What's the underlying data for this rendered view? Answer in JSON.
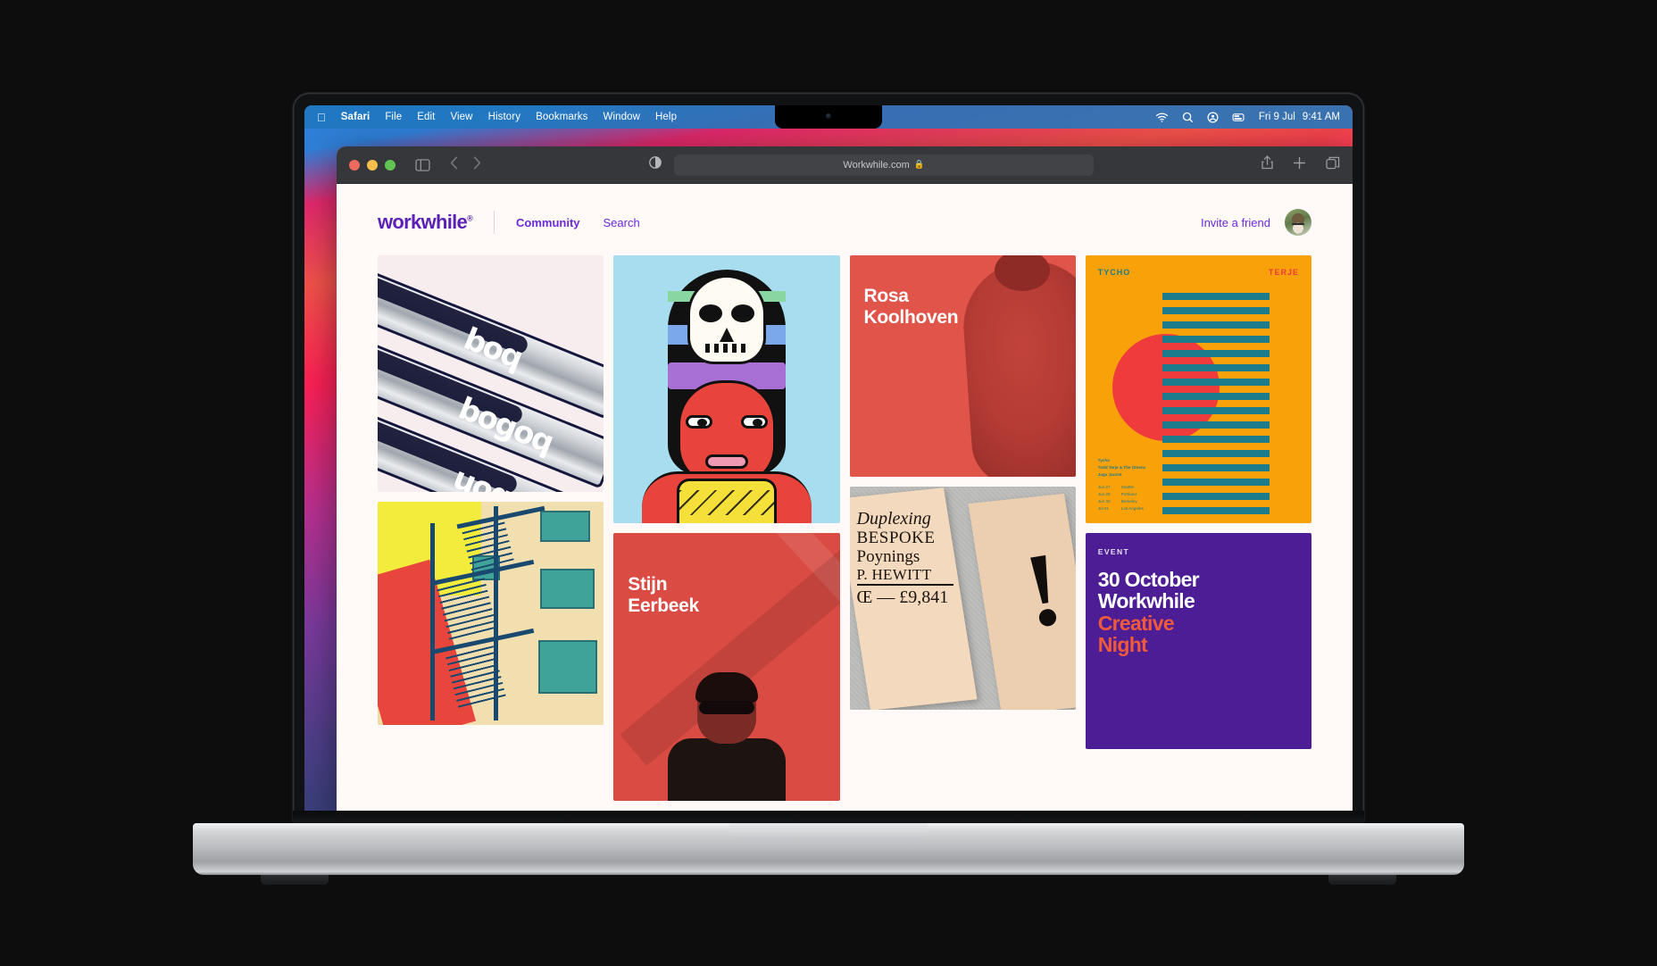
{
  "menubar": {
    "apple_icon": "apple-logo",
    "items": [
      "Safari",
      "File",
      "Edit",
      "View",
      "History",
      "Bookmarks",
      "Window",
      "Help"
    ],
    "active_app": "Safari",
    "status_icons": [
      "wifi-icon",
      "search-icon",
      "control-center-icon",
      "battery-icon"
    ],
    "date": "Fri 9 Jul",
    "time": "9:41 AM"
  },
  "safari": {
    "traffic_lights": [
      "close-button",
      "minimize-button",
      "zoom-button"
    ],
    "sidebar_icon": "sidebar-toggle-icon",
    "back_icon": "back-chevron-icon",
    "forward_icon": "forward-chevron-icon",
    "reader_icon": "reader-view-icon",
    "url": "Workwhile.com",
    "lock_icon": "lock-icon",
    "share_icon": "share-icon",
    "new_tab_icon": "plus-icon",
    "tabs_icon": "tab-overview-icon"
  },
  "site": {
    "logo": "workwhile",
    "logo_mark": "®",
    "nav": [
      {
        "label": "Community",
        "active": true
      },
      {
        "label": "Search",
        "active": false
      }
    ],
    "invite_label": "Invite a friend",
    "avatar": "user-avatar"
  },
  "gallery": {
    "cards": [
      {
        "id": "bottles",
        "type": "image",
        "title": "",
        "alt": "Wine bottles with bold white lettering",
        "lettering": [
          "boq",
          "bogoq",
          "uoquq"
        ],
        "bg": "#f7ecee"
      },
      {
        "id": "illustration",
        "type": "image",
        "alt": "Illustrated woman with skull headdress",
        "bg": "#a8dcef"
      },
      {
        "id": "rosa",
        "type": "portrait",
        "name_line1": "Rosa",
        "name_line2": "Koolhoven",
        "bg": "#e0544a"
      },
      {
        "id": "tycho",
        "type": "poster",
        "left_label": "TYCHO",
        "right_label": "TERJE",
        "credits": [
          "Tycho",
          "Todd Terje & The Olsens",
          "Jaga Jazzist"
        ],
        "dates": [
          {
            "date": "Jun 27",
            "city": "Seattle"
          },
          {
            "date": "Jun 28",
            "city": "Portland"
          },
          {
            "date": "Jun 30",
            "city": "Berkeley"
          },
          {
            "date": "Jul 01",
            "city": "Los Angeles"
          }
        ],
        "bg": "#f9a108",
        "accent_teal": "#1c7c8c",
        "accent_red": "#ef3b3b"
      },
      {
        "id": "fire-escape",
        "type": "image",
        "alt": "Illustrated building fire escape",
        "bg": "#f0dca6"
      },
      {
        "id": "stijn",
        "type": "portrait",
        "name_line1": "Stijn",
        "name_line2": "Eerbeek",
        "bg": "#d94b43"
      },
      {
        "id": "type-specimen",
        "type": "image",
        "alt": "Open type specimen book",
        "lines": [
          "Duplexing",
          "BESPOKE",
          "Poynings",
          "P. HEWITT",
          "Œ  —  £9,841"
        ],
        "bg": "#bfbfbd"
      },
      {
        "id": "event",
        "type": "event",
        "tag": "EVENT",
        "line1": "30 October",
        "line2": "Workwhile",
        "line3": "Creative",
        "line4": "Night",
        "bg": "#4c1d95",
        "accent": "#f05a3c"
      }
    ]
  }
}
